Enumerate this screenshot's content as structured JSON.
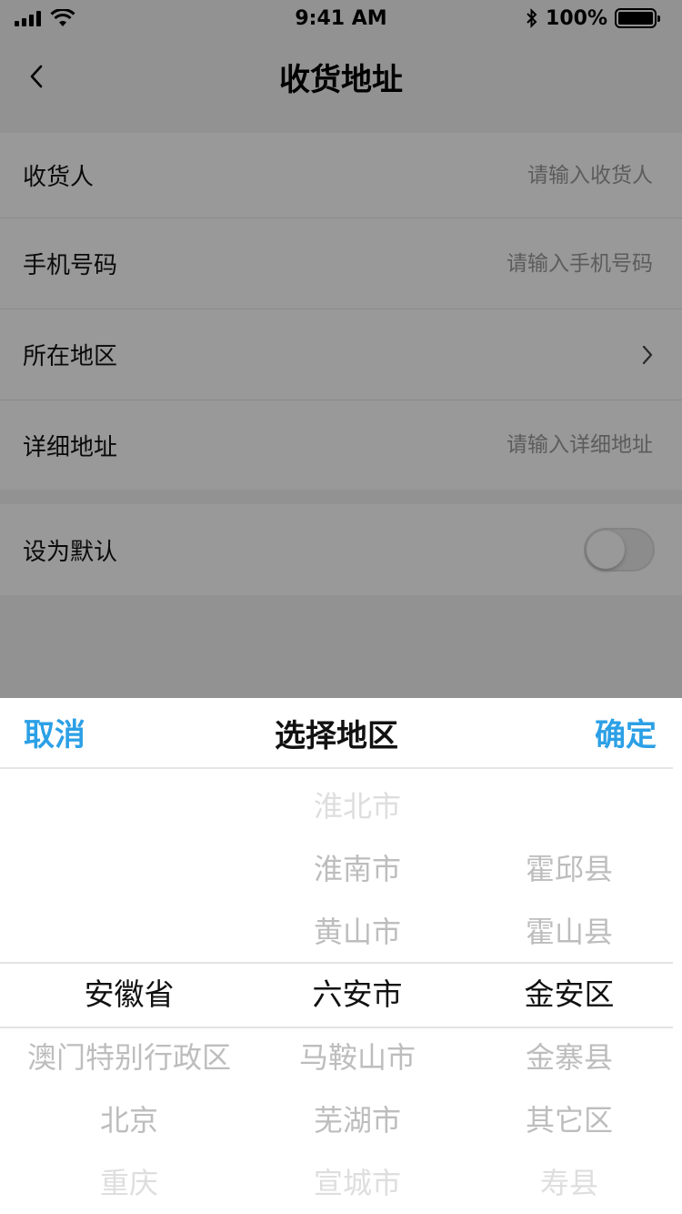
{
  "status_bar": {
    "time": "9:41 AM",
    "battery": "100%"
  },
  "nav": {
    "title": "收货地址"
  },
  "form": {
    "receiver": {
      "label": "收货人",
      "placeholder": "请输入收货人"
    },
    "phone": {
      "label": "手机号码",
      "placeholder": "请输入手机号码"
    },
    "region": {
      "label": "所在地区"
    },
    "address": {
      "label": "详细地址",
      "placeholder": "请输入详细地址"
    },
    "default": {
      "label": "设为默认",
      "on": false
    }
  },
  "picker": {
    "cancel": "取消",
    "title": "选择地区",
    "confirm": "确定",
    "province": {
      "above": [],
      "selected": "安徽省",
      "below": [
        "澳门特别行政区",
        "北京",
        "重庆"
      ]
    },
    "city": {
      "above": [
        "淮北市",
        "淮南市",
        "黄山市"
      ],
      "selected": "六安市",
      "below": [
        "马鞍山市",
        "芜湖市",
        "宣城市"
      ]
    },
    "district": {
      "above": [
        "霍邱县",
        "霍山县"
      ],
      "selected": "金安区",
      "below": [
        "金寨县",
        "其它区",
        "寿县"
      ]
    }
  },
  "colors": {
    "accent": "#2ca0e6",
    "mask": "rgba(0,0,0,0.4)"
  }
}
